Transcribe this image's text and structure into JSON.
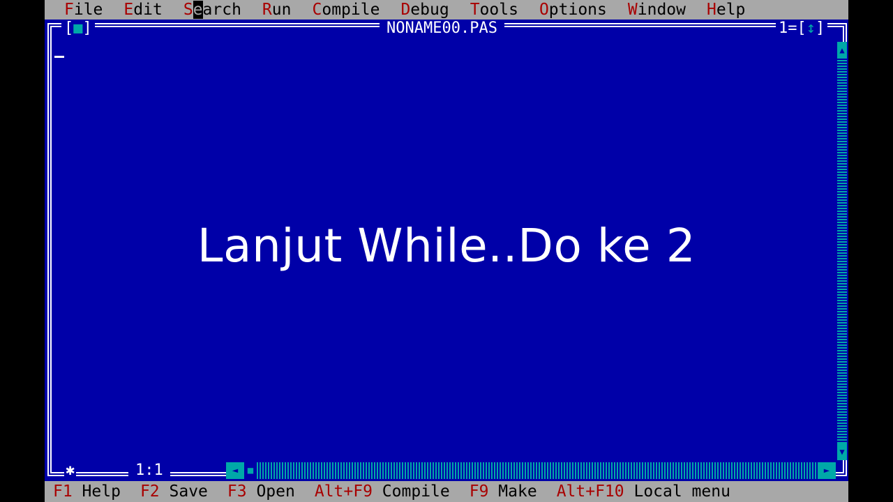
{
  "menu": {
    "items": [
      {
        "hot": "F",
        "rest": "ile"
      },
      {
        "hot": "E",
        "rest": "dit"
      },
      {
        "hot": "S",
        "caret": "e",
        "rest": "arch"
      },
      {
        "hot": "R",
        "rest": "un"
      },
      {
        "hot": "C",
        "rest": "ompile"
      },
      {
        "hot": "D",
        "rest": "ebug"
      },
      {
        "hot": "T",
        "rest": "ools"
      },
      {
        "hot": "O",
        "rest": "ptions"
      },
      {
        "hot": "W",
        "rest": "indow"
      },
      {
        "hot": "H",
        "rest": "elp"
      }
    ]
  },
  "window": {
    "title": "NONAME00.PAS",
    "close_left": "[",
    "close_mark": "■",
    "close_right": "]",
    "number_prefix": "1=[",
    "zoom_mark": "↕",
    "number_suffix": "]",
    "cursor_position": "1:1",
    "modified_mark": "✱"
  },
  "overlay": {
    "caption": "Lanjut While..Do ke 2"
  },
  "statusbar": {
    "items": [
      {
        "key": "F1",
        "label": " Help"
      },
      {
        "key": "F2",
        "label": " Save"
      },
      {
        "key": "F3",
        "label": " Open"
      },
      {
        "key": "Alt+F9",
        "label": " Compile"
      },
      {
        "key": "F9",
        "label": " Make"
      },
      {
        "key": "Alt+F10",
        "label": " Local menu"
      }
    ]
  },
  "colors": {
    "editor_bg": "#0000a8",
    "menu_bg": "#a8a8a8",
    "hotkey": "#a80000",
    "scrollbar": "#00a8a8"
  },
  "icons": {
    "up_arrow": "▲",
    "down_arrow": "▼",
    "left_arrow": "◄",
    "right_arrow": "►",
    "thumb": "■"
  }
}
